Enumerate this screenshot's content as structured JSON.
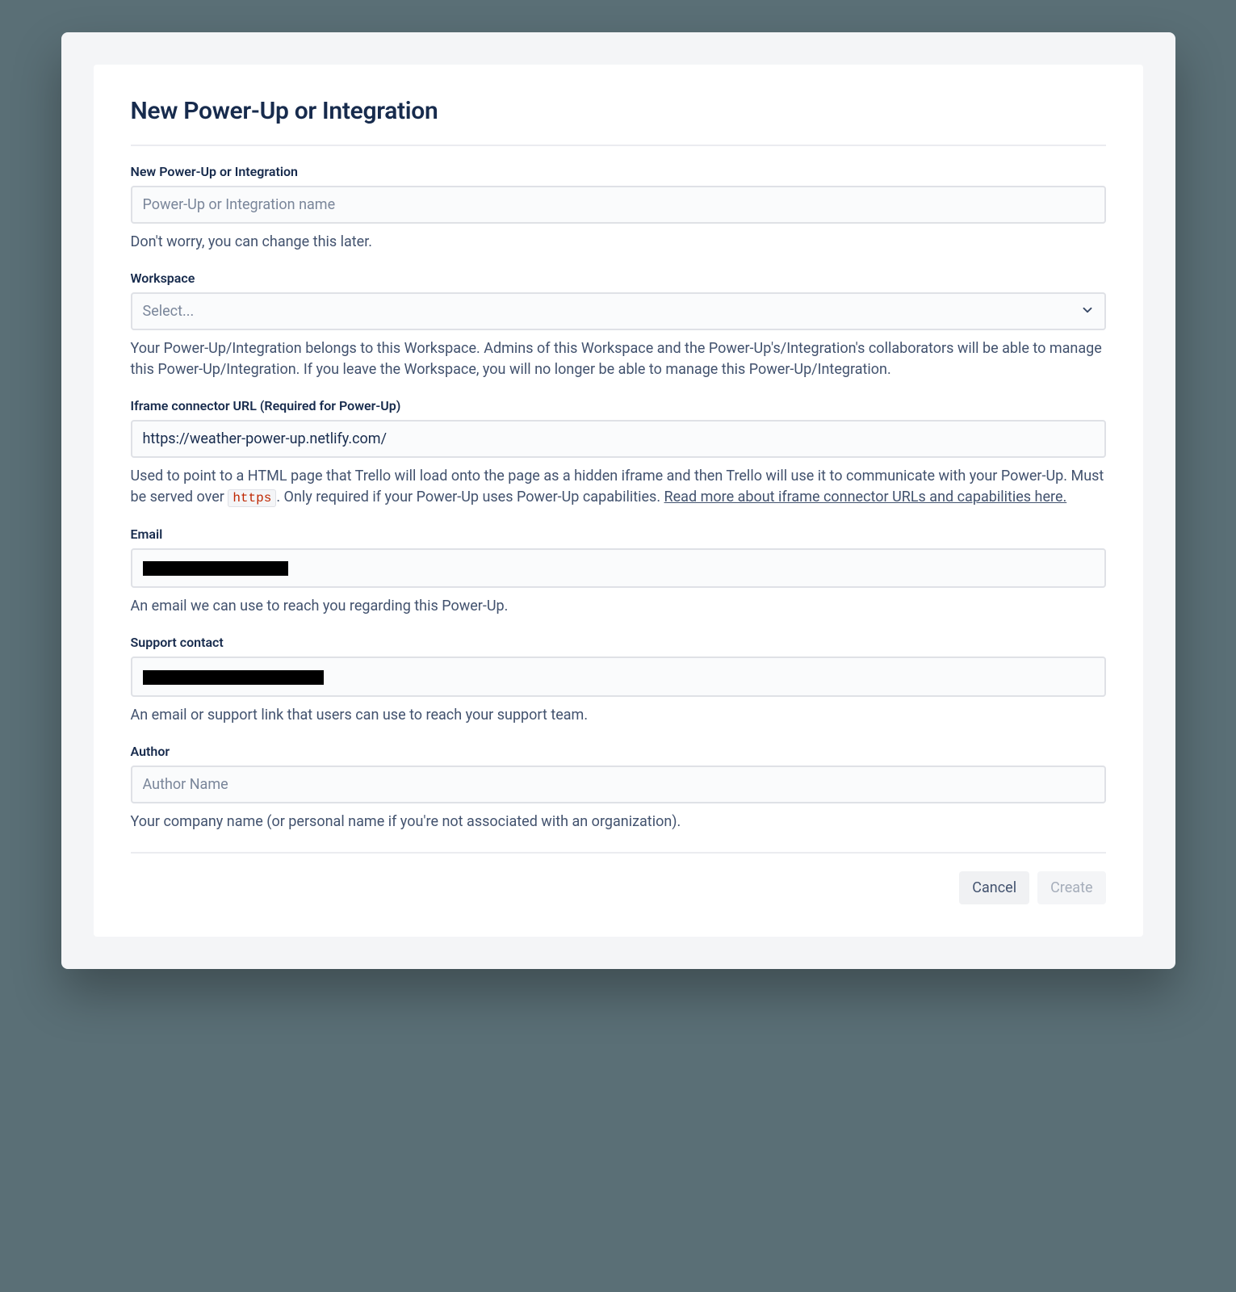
{
  "page": {
    "title": "New Power-Up or Integration"
  },
  "fields": {
    "name": {
      "label": "New Power-Up or Integration",
      "placeholder": "Power-Up or Integration name",
      "help": "Don't worry, you can change this later."
    },
    "workspace": {
      "label": "Workspace",
      "placeholder": "Select...",
      "help": "Your Power-Up/Integration belongs to this Workspace. Admins of this Workspace and the Power-Up's/Integration's collaborators will be able to manage this Power-Up/Integration. If you leave the Workspace, you will no longer be able to manage this Power-Up/Integration."
    },
    "iframe": {
      "label": "Iframe connector URL (Required for Power-Up)",
      "value": "https://weather-power-up.netlify.com/",
      "help_before": "Used to point to a HTML page that Trello will load onto the page as a hidden iframe and then Trello will use it to communicate with your Power-Up. Must be served over ",
      "help_code": "https",
      "help_after": ". Only required if your Power-Up uses Power-Up capabilities. ",
      "help_link": "Read more about iframe connector URLs and capabilities here."
    },
    "email": {
      "label": "Email",
      "help": "An email we can use to reach you regarding this Power-Up."
    },
    "support": {
      "label": "Support contact",
      "help": "An email or support link that users can use to reach your support team."
    },
    "author": {
      "label": "Author",
      "placeholder": "Author Name",
      "help": "Your company name (or personal name if you're not associated with an organization)."
    }
  },
  "actions": {
    "cancel": "Cancel",
    "create": "Create"
  }
}
